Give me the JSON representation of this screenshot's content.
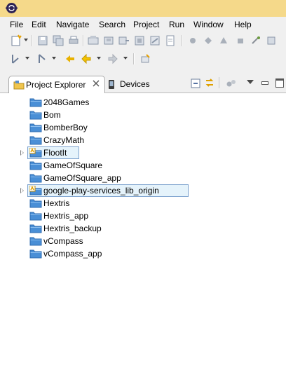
{
  "menubar": {
    "items": [
      "File",
      "Edit",
      "Navigate",
      "Search",
      "Project",
      "Run",
      "Window",
      "Help"
    ]
  },
  "toolbar1": {
    "icons": [
      "new-wizard-icon",
      "save-icon",
      "save-all-icon",
      "print-icon",
      "sdk-manager-icon",
      "avd-manager-icon",
      "android-lint-icon",
      "new-android-project-icon",
      "new-android-test-icon",
      "new-xml-file-icon",
      "debug-icon",
      "run-icon",
      "external-tools-icon",
      "new-java-class-icon"
    ]
  },
  "toolbar2": {
    "icons": [
      "next-annotation-icon",
      "previous-annotation-icon",
      "last-edit-location-icon",
      "back-icon",
      "forward-icon",
      "pin-editor-icon"
    ]
  },
  "tabs": [
    {
      "label": "Project Explorer",
      "active": true
    },
    {
      "label": "Devices",
      "active": false
    }
  ],
  "view_toolbar": [
    "collapse-all-icon",
    "link-with-editor-icon",
    "filters-icon",
    "view-menu-icon",
    "minimize-icon",
    "maximize-icon"
  ],
  "projects": [
    {
      "name": "2048Games",
      "expandable": false,
      "selected": false,
      "android_overlay": false
    },
    {
      "name": "Bom",
      "expandable": false,
      "selected": false,
      "android_overlay": false
    },
    {
      "name": "BomberBoy",
      "expandable": false,
      "selected": false,
      "android_overlay": false
    },
    {
      "name": "CrazyMath",
      "expandable": false,
      "selected": false,
      "android_overlay": false
    },
    {
      "name": "FlootIt",
      "expandable": true,
      "selected": true,
      "android_overlay": true
    },
    {
      "name": "GameOfSquare",
      "expandable": false,
      "selected": false,
      "android_overlay": false
    },
    {
      "name": "GameOfSquare_app",
      "expandable": false,
      "selected": false,
      "android_overlay": false
    },
    {
      "name": "google-play-services_lib_origin",
      "expandable": true,
      "selected": true,
      "android_overlay": true
    },
    {
      "name": "Hextris",
      "expandable": false,
      "selected": false,
      "android_overlay": false
    },
    {
      "name": "Hextris_app",
      "expandable": false,
      "selected": false,
      "android_overlay": false
    },
    {
      "name": "Hextris_backup",
      "expandable": false,
      "selected": false,
      "android_overlay": false
    },
    {
      "name": "vCompass",
      "expandable": false,
      "selected": false,
      "android_overlay": false
    },
    {
      "name": "vCompass_app",
      "expandable": false,
      "selected": false,
      "android_overlay": false
    }
  ],
  "colors": {
    "titlebar": "#f5d98a",
    "chrome": "#f0f0f0",
    "folder": "#4a8fd6",
    "selection_fill": "#e5f3fb",
    "selection_border": "#7da2ce"
  }
}
